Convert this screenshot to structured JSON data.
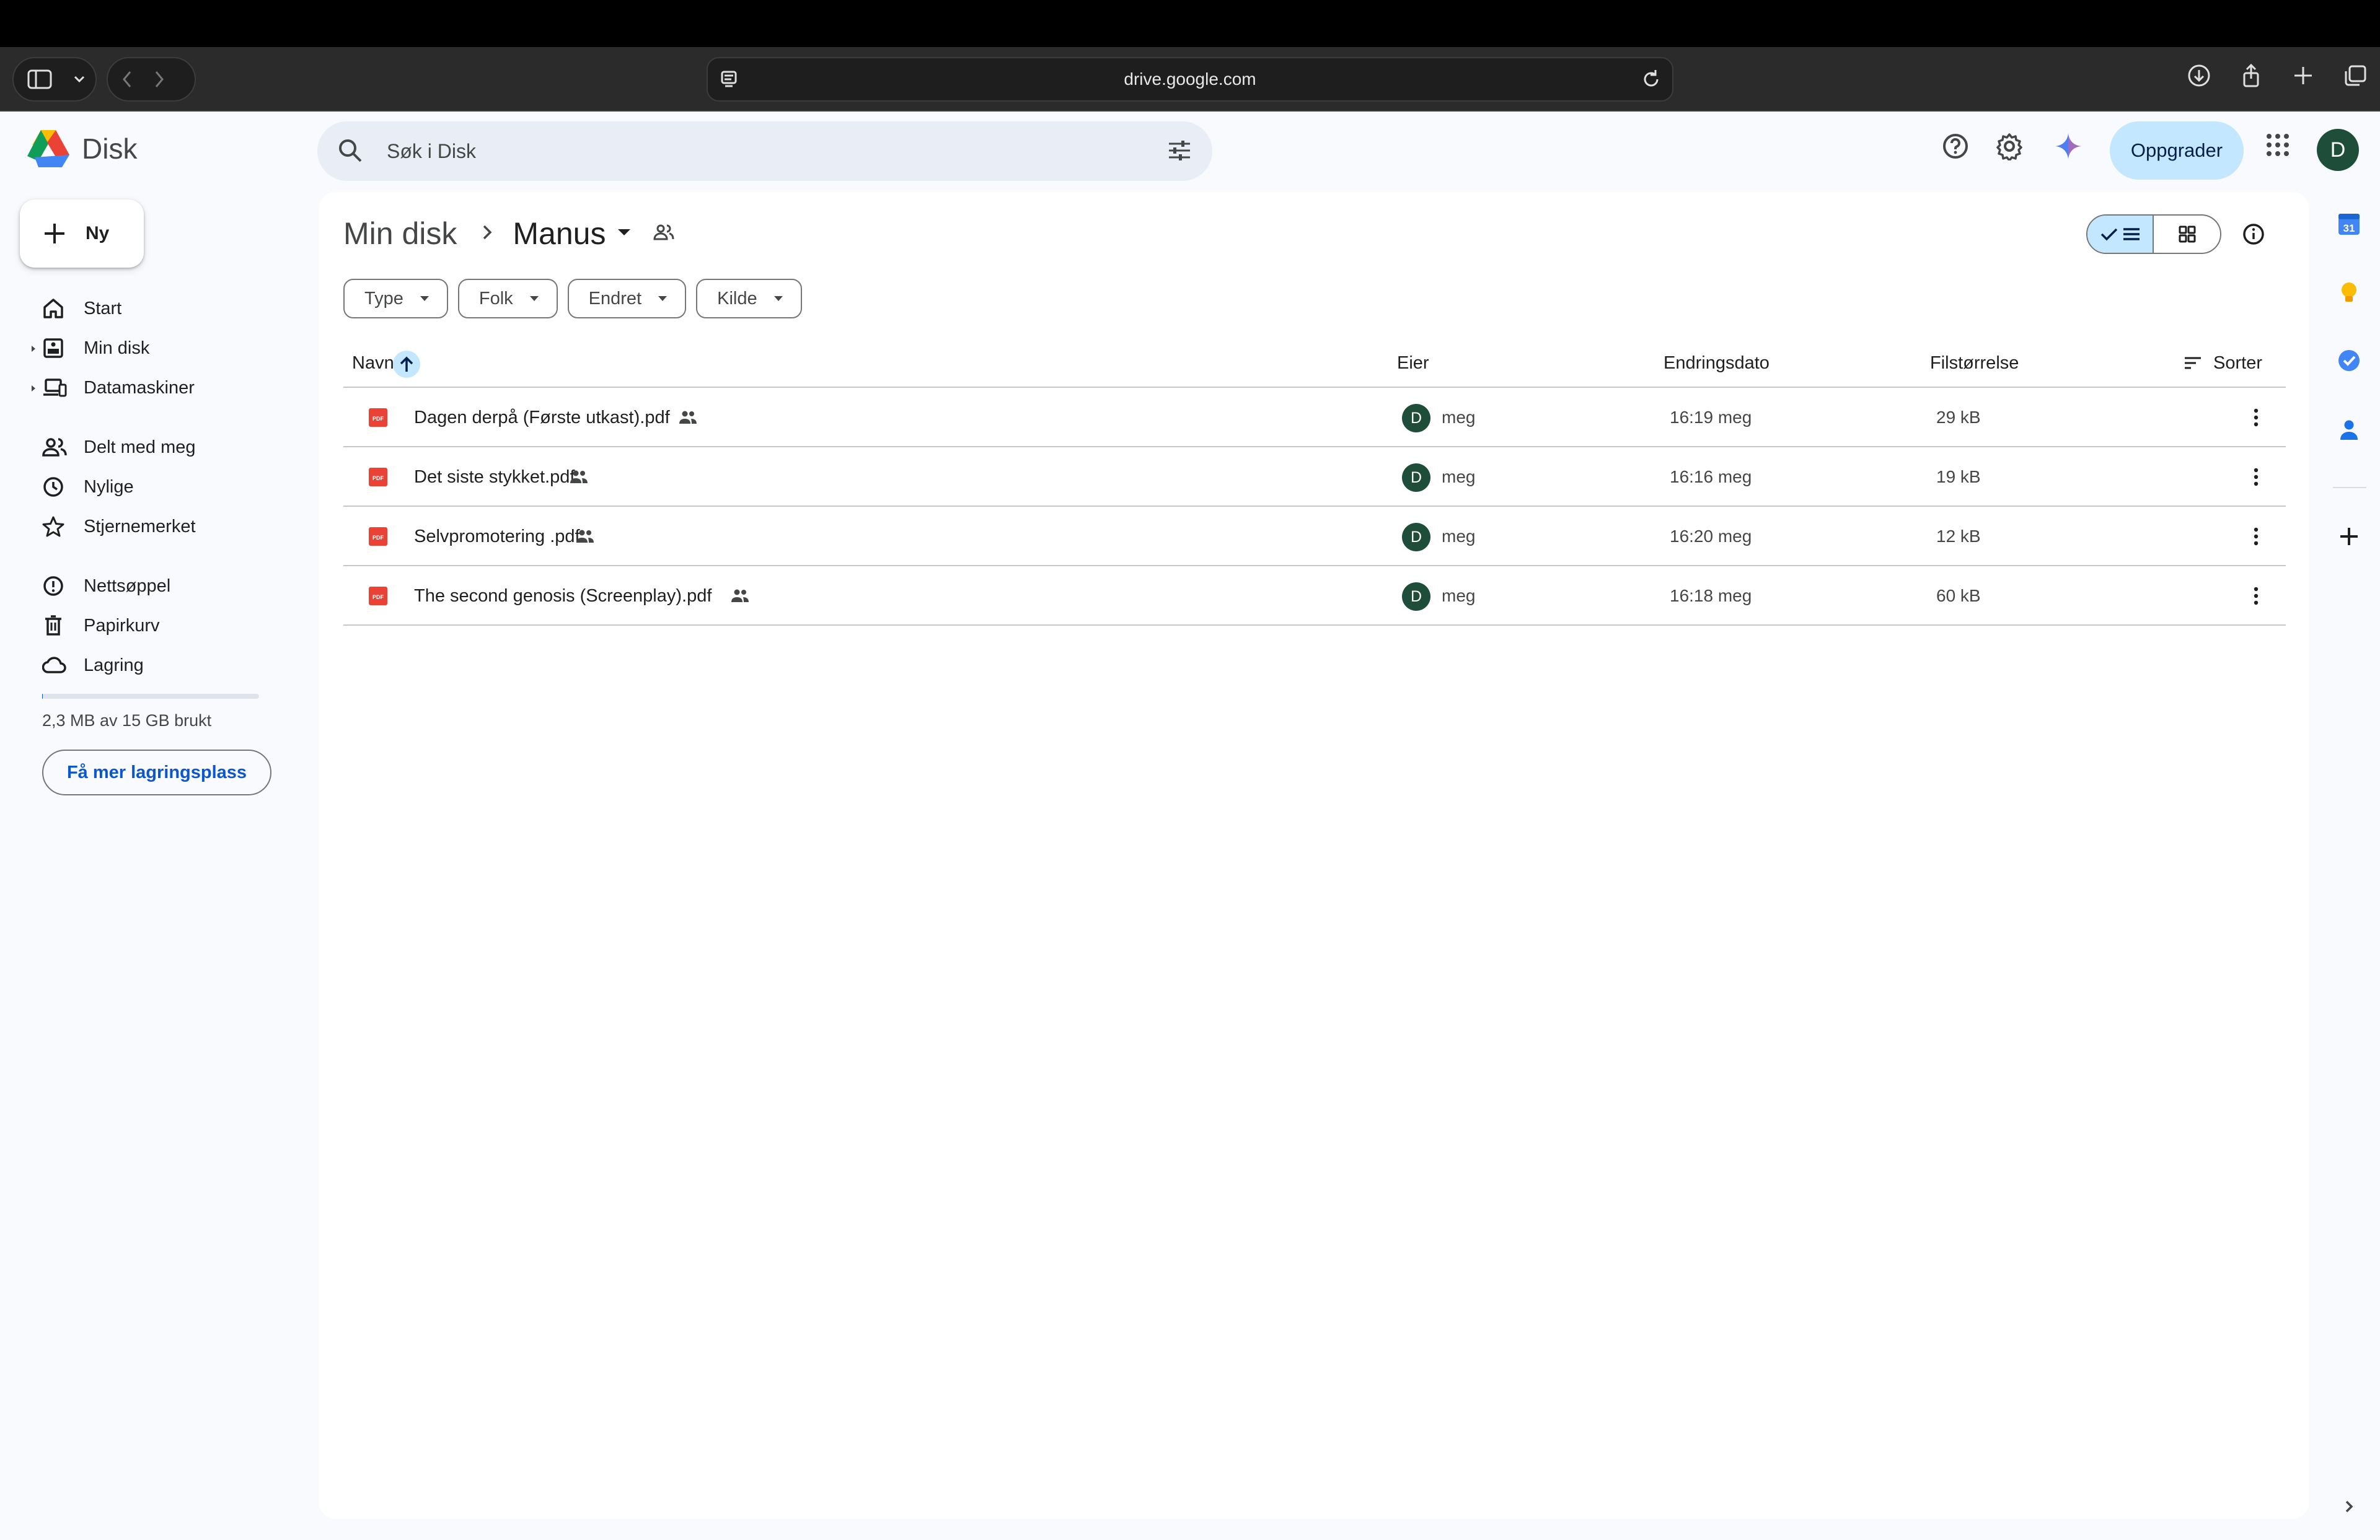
{
  "browser": {
    "url": "drive.google.com"
  },
  "app": {
    "name": "Disk",
    "search_placeholder": "Søk i Disk",
    "upgrade_label": "Oppgrader",
    "avatar_initial": "D"
  },
  "sidebar": {
    "new_label": "Ny",
    "items": [
      {
        "label": "Start",
        "icon": "home-icon"
      },
      {
        "label": "Min disk",
        "icon": "my-drive-icon"
      },
      {
        "label": "Datamaskiner",
        "icon": "computers-icon"
      },
      {
        "label": "Delt med meg",
        "icon": "shared-with-me-icon"
      },
      {
        "label": "Nylige",
        "icon": "clock-icon"
      },
      {
        "label": "Stjernemerket",
        "icon": "star-icon"
      },
      {
        "label": "Nettsøppel",
        "icon": "spam-icon"
      },
      {
        "label": "Papirkurv",
        "icon": "trash-icon"
      },
      {
        "label": "Lagring",
        "icon": "cloud-icon"
      }
    ],
    "storage_text": "2,3 MB av 15 GB brukt",
    "storage_fraction": 0.0002,
    "more_storage_label": "Få mer lagringsplass"
  },
  "main": {
    "breadcrumb": {
      "parent": "Min disk",
      "current": "Manus"
    },
    "filters": [
      "Type",
      "Folk",
      "Endret",
      "Kilde"
    ],
    "columns": {
      "name": "Navn",
      "owner": "Eier",
      "modified": "Endringsdato",
      "size": "Filstørrelse",
      "sort": "Sorter"
    },
    "files": [
      {
        "name": "Dagen derpå (Første utkast).pdf",
        "owner_initial": "D",
        "owner": "meg",
        "modified": "16:19 meg",
        "size": "29 kB"
      },
      {
        "name": "Det siste stykket.pdf",
        "owner_initial": "D",
        "owner": "meg",
        "modified": "16:16 meg",
        "size": "19 kB"
      },
      {
        "name": "Selvpromotering .pdf",
        "owner_initial": "D",
        "owner": "meg",
        "modified": "16:20 meg",
        "size": "12 kB"
      },
      {
        "name": "The second genosis (Screenplay).pdf",
        "owner_initial": "D",
        "owner": "meg",
        "modified": "16:18 meg",
        "size": "60 kB"
      }
    ]
  },
  "side_panel": {
    "calendar_day": "31"
  },
  "colors": {
    "accent": "#0b57d0",
    "selected_bg": "#c2e7ff",
    "pdf_red": "#ea4335",
    "avatar_green": "#1e4d3a"
  }
}
